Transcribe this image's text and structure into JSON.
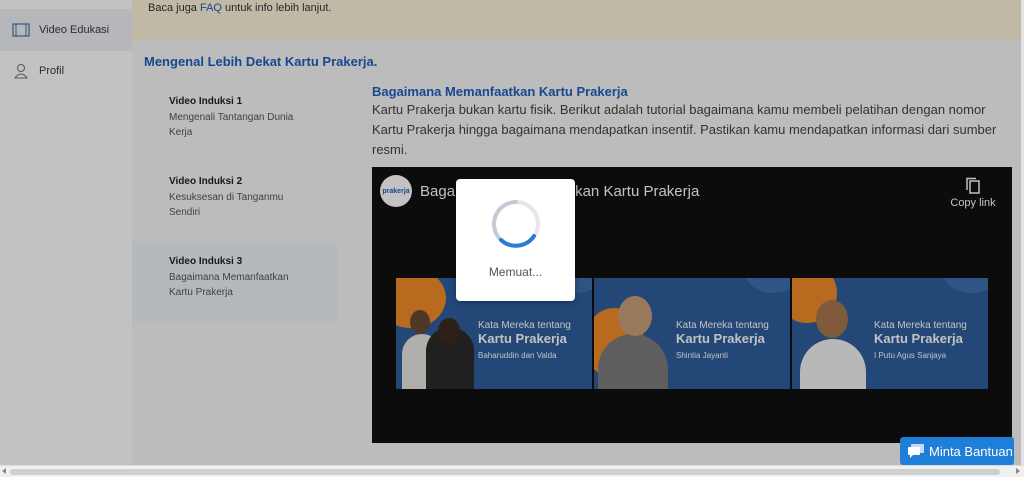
{
  "sidebar": {
    "items": [
      {
        "label": "Video Edukasi",
        "icon": "film-icon"
      },
      {
        "label": "Profil",
        "icon": "profile-icon"
      }
    ]
  },
  "topbar": {
    "prefix": "Baca juga ",
    "link": "FAQ",
    "suffix": " untuk info lebih lanjut."
  },
  "section_heading": "Mengenal Lebih Dekat Kartu Prakerja.",
  "episodes": [
    {
      "title": "Video Induksi 1",
      "subtitle": "Mengenali Tantangan Dunia Kerja"
    },
    {
      "title": "Video Induksi 2",
      "subtitle": "Kesuksesan di Tanganmu Sendiri"
    },
    {
      "title": "Video Induksi 3",
      "subtitle": "Bagaimana Memanfaatkan Kartu Prakerja"
    }
  ],
  "video": {
    "heading": "Bagaimana Memanfaatkan Kartu Prakerja",
    "description": "Kartu Prakerja bukan kartu fisik. Berikut adalah tutorial bagaimana kamu membeli pelatihan dengan nomor Kartu Prakerja hingga bagaimana mendapatkan insentif. Pastikan kamu mendapatkan informasi dari sumber resmi.",
    "player_title": "Bagaimana Memanfaatkan Kartu Prakerja",
    "logo_text": "prakerja",
    "copy_label": "Copy link",
    "thumbnails": [
      {
        "line1": "Kata Mereka tentang",
        "line2": "Kartu Prakerja",
        "name": "Baharuddin dan Valda"
      },
      {
        "line1": "Kata Mereka tentang",
        "line2": "Kartu Prakerja",
        "name": "Shintia Jayanti"
      },
      {
        "line1": "Kata Mereka tentang",
        "line2": "Kartu Prakerja",
        "name": "I Putu Agus Sanjaya"
      }
    ]
  },
  "loader": {
    "text": "Memuat..."
  },
  "help_button": {
    "label": "Minta Bantuan"
  },
  "colors": {
    "accent": "#1f5fbf",
    "help": "#1e7ed8",
    "thumb_bg": "#2f5f9e",
    "thumb_blob": "#f28c28"
  }
}
